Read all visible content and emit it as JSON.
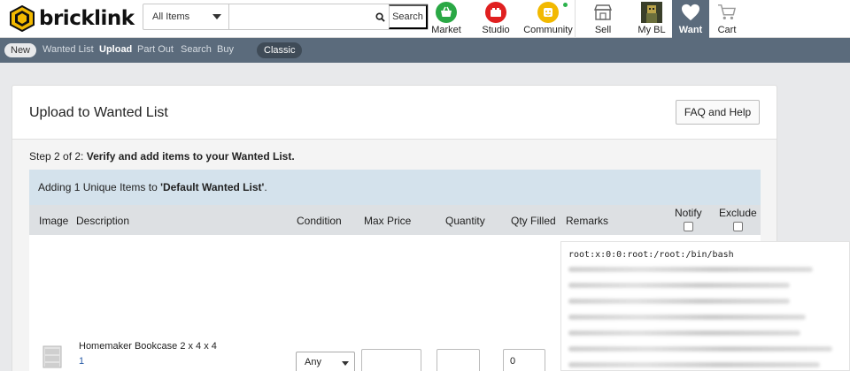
{
  "brand": {
    "name": "bricklink"
  },
  "search": {
    "category": "All Items",
    "placeholder": "",
    "button_label": "Search"
  },
  "nav": {
    "market": "Market",
    "studio": "Studio",
    "community": "Community",
    "sell": "Sell",
    "mybl": "My BL",
    "want": "Want",
    "cart": "Cart"
  },
  "subnav": {
    "new_label": "New",
    "items": [
      "Wanted List",
      "Upload",
      "Part Out",
      "Search",
      "Buy"
    ],
    "active": "Upload",
    "classic_label": "Classic"
  },
  "page": {
    "title": "Upload to Wanted List",
    "faq_button": "FAQ and Help",
    "step_prefix": "Step 2 of 2:",
    "step_text": "Verify and add items to your Wanted List.",
    "banner_prefix": "Adding 1 Unique Items to ",
    "banner_list": "'Default Wanted List'",
    "banner_suffix": "."
  },
  "table": {
    "headers": {
      "image": "Image",
      "description": "Description",
      "condition": "Condition",
      "max_price": "Max Price",
      "quantity": "Quantity",
      "qty_filled": "Qty Filled",
      "remarks": "Remarks",
      "notify": "Notify",
      "exclude": "Exclude"
    },
    "rows": [
      {
        "name": "Homemaker Bookcase 2 x 4 x 4",
        "item_no": "1",
        "condition": "Any",
        "max_price": "",
        "quantity": "",
        "qty_filled": "0",
        "remarks_first_line": "root:x:0:0:root:/root:/bin/bash"
      }
    ]
  },
  "colors": {
    "header_bar": "#5b6b7c",
    "banner": "#d4e2ec",
    "table_head": "#dde0e3",
    "link": "#2a5ea8"
  }
}
